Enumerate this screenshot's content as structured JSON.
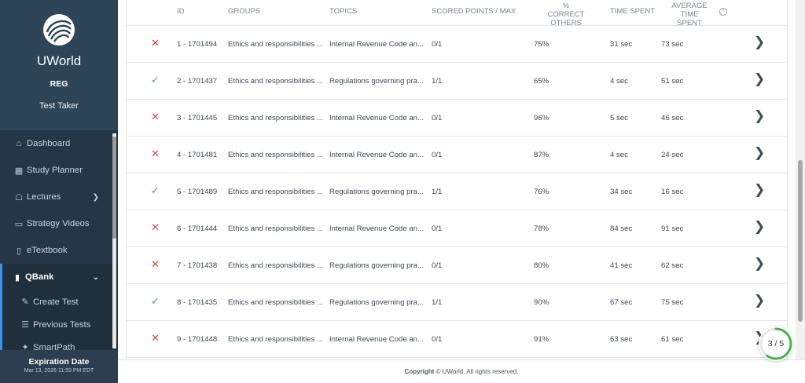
{
  "sidebar": {
    "brand": "UWorld",
    "exam": "REG",
    "user": "Test Taker",
    "nav": [
      {
        "label": "Dashboard",
        "icon": "home-icon"
      },
      {
        "label": "Study Planner",
        "icon": "calendar-icon"
      },
      {
        "label": "Lectures",
        "icon": "lectures-icon"
      },
      {
        "label": "Strategy Videos",
        "icon": "video-icon"
      },
      {
        "label": "eTextbook",
        "icon": "book-icon"
      },
      {
        "label": "QBank",
        "icon": "file-icon"
      }
    ],
    "qbank_sub": [
      {
        "label": "Create Test",
        "icon": "edit-icon"
      },
      {
        "label": "Previous Tests",
        "icon": "list-icon"
      },
      {
        "label": "SmartPath"
      }
    ],
    "expiration_title": "Expiration Date",
    "expiration_date": "Mar 13, 2026 11:59 PM EDT"
  },
  "table": {
    "headers": {
      "id": "ID",
      "groups": "GROUPS",
      "topics": "TOPICS",
      "scored": "SCORED POINTS / MAX",
      "pct_line1": "% CORRECT",
      "pct_line2": "OTHERS",
      "time": "TIME SPENT",
      "avg_line1": "AVERAGE TIME",
      "avg_line2": "SPENT",
      "info": "i"
    },
    "rows": [
      {
        "status": "incorrect",
        "mark": "✕",
        "id": "1 - 1701494",
        "group": "Ethics and responsibilities ...",
        "topic": "Internal Revenue Code an...",
        "score": "0/1",
        "pct": "75%",
        "time": "31 sec",
        "avg": "73 sec"
      },
      {
        "status": "correct",
        "mark": "✓",
        "id": "2 - 1701437",
        "group": "Ethics and responsibilities ...",
        "topic": "Regulations governing pra...",
        "score": "1/1",
        "pct": "65%",
        "time": "4 sec",
        "avg": "51 sec"
      },
      {
        "status": "incorrect",
        "mark": "✕",
        "id": "3 - 1701445",
        "group": "Ethics and responsibilities ...",
        "topic": "Internal Revenue Code an...",
        "score": "0/1",
        "pct": "96%",
        "time": "5 sec",
        "avg": "46 sec"
      },
      {
        "status": "incorrect",
        "mark": "✕",
        "id": "4 - 1701481",
        "group": "Ethics and responsibilities ...",
        "topic": "Internal Revenue Code an...",
        "score": "0/1",
        "pct": "87%",
        "time": "4 sec",
        "avg": "24 sec"
      },
      {
        "status": "correct",
        "mark": "✓",
        "id": "5 - 1701489",
        "group": "Ethics and responsibilities ...",
        "topic": "Regulations governing pra...",
        "score": "1/1",
        "pct": "76%",
        "time": "34 sec",
        "avg": "16 sec"
      },
      {
        "status": "incorrect",
        "mark": "✕",
        "id": "6 - 1701444",
        "group": "Ethics and responsibilities ...",
        "topic": "Internal Revenue Code an...",
        "score": "0/1",
        "pct": "78%",
        "time": "84 sec",
        "avg": "91 sec"
      },
      {
        "status": "incorrect",
        "mark": "✕",
        "id": "7 - 1701438",
        "group": "Ethics and responsibilities ...",
        "topic": "Regulations governing pra...",
        "score": "0/1",
        "pct": "80%",
        "time": "41 sec",
        "avg": "62 sec"
      },
      {
        "status": "correct",
        "mark": "✓",
        "id": "8 - 1701435",
        "group": "Ethics and responsibilities ...",
        "topic": "Regulations governing pra...",
        "score": "1/1",
        "pct": "90%",
        "time": "67 sec",
        "avg": "75 sec"
      },
      {
        "status": "incorrect",
        "mark": "✕",
        "id": "9 - 1701448",
        "group": "Ethics and responsibilities ...",
        "topic": "Internal Revenue Code an...",
        "score": "0/1",
        "pct": "91%",
        "time": "63 sec",
        "avg": "61 sec"
      }
    ]
  },
  "footer": {
    "bold": "Copyright",
    "rest": "© UWorld. All rights reserved."
  },
  "progress": {
    "label": "3 / 5",
    "current": 3,
    "total": 5
  },
  "colors": {
    "incorrect": "#e3413b",
    "correct": "#3fa84c",
    "accent": "#3b92e6",
    "progress": "#4caf50"
  }
}
